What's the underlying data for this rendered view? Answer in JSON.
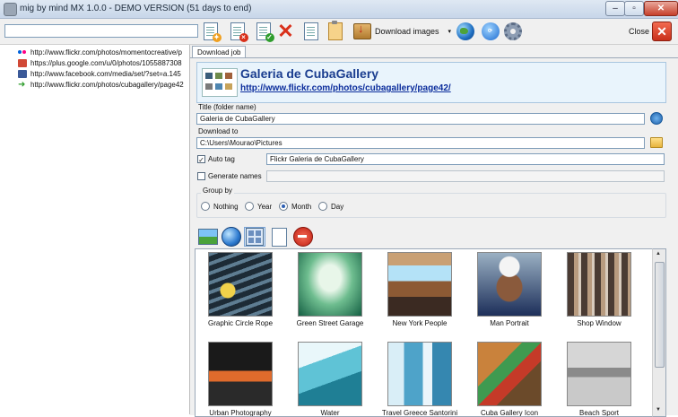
{
  "window": {
    "title": "mig by mind MX 1.0.0 - DEMO VERSION (51 days to end)"
  },
  "toolbar": {
    "url_value": "",
    "download_label": "Download images",
    "close_label": "Close",
    "caret": "▾"
  },
  "left_panel": {
    "urls": [
      {
        "text": "http://www.flickr.com/photos/momentocreative/p",
        "favicon": "flickr"
      },
      {
        "text": "https://plus.google.com/u/0/photos/1055887308",
        "favicon": "google-plus"
      },
      {
        "text": "http://www.facebook.com/media/set/?set=a.145",
        "favicon": "facebook"
      },
      {
        "text": "http://www.flickr.com/photos/cubagallery/page42",
        "favicon": "green-arrow"
      }
    ]
  },
  "tab": {
    "label": "Download job"
  },
  "job": {
    "gallery_title": "Galeria de CubaGallery",
    "gallery_url": "http://www.flickr.com/photos/cubagallery/page42/",
    "title_label": "Title (folder name)",
    "title_value": "Galeria de CubaGallery",
    "download_to_label": "Download to",
    "download_to_value": "C:\\Users\\Mourao\\Pictures",
    "auto_tag_label": "Auto tag",
    "auto_tag_checked": true,
    "auto_tag_value": "Flickr  Galeria de CubaGallery",
    "generate_names_label": "Generate names",
    "generate_names_checked": false,
    "group_by_label": "Group by",
    "group_by_options": [
      "Nothing",
      "Year",
      "Month",
      "Day"
    ],
    "group_by_selected": "Month"
  },
  "gallery": {
    "items": [
      {
        "caption": "Graphic   Circle   Rope"
      },
      {
        "caption": "Green   Street   Garage"
      },
      {
        "caption": "New York People"
      },
      {
        "caption": "Man   Portrait"
      },
      {
        "caption": "Shop Window"
      },
      {
        "caption": "Urban Photography"
      },
      {
        "caption": "Water"
      },
      {
        "caption": "Travel   Greece   Santorini"
      },
      {
        "caption": "Cuba Gallery Icon"
      },
      {
        "caption": "Beach Sport"
      }
    ]
  },
  "colors": {
    "title_link": "#0b2d9c",
    "header_bg": "#e9f4fc",
    "close_red": "#c9301a"
  }
}
